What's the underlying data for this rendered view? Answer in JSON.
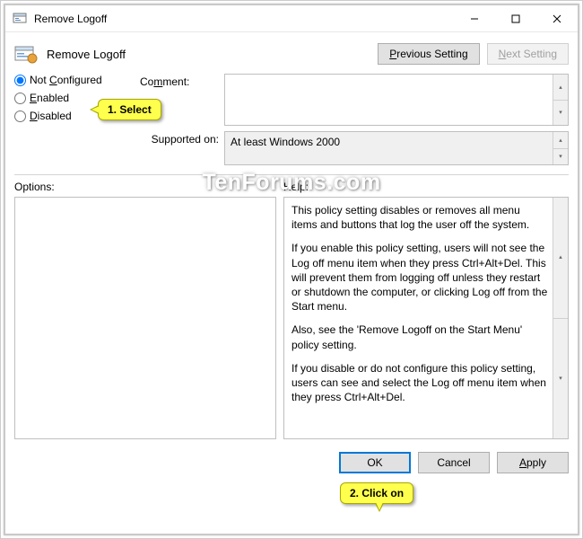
{
  "titlebar": {
    "title": "Remove Logoff"
  },
  "header": {
    "title": "Remove Logoff"
  },
  "nav": {
    "prev": "Previous Setting",
    "next": "Next Setting"
  },
  "radios": {
    "not_configured": "Not Configured",
    "enabled": "Enabled",
    "disabled": "Disabled"
  },
  "fields": {
    "comment_label": "Comment:",
    "comment_value": "",
    "supported_label": "Supported on:",
    "supported_value": "At least Windows 2000"
  },
  "lower": {
    "options_label": "Options:",
    "help_label": "Help:",
    "help_p1": "This policy setting disables or removes all menu items and buttons that log the user off the system.",
    "help_p2": "If you enable this policy setting, users will not see the Log off menu item when they press Ctrl+Alt+Del. This will prevent them from logging off unless they restart or shutdown the computer, or clicking Log off from the Start menu.",
    "help_p3": "Also, see the 'Remove Logoff on the Start Menu' policy setting.",
    "help_p4": "If you disable or do not configure this policy setting, users can see and select the Log off menu item when they press Ctrl+Alt+Del."
  },
  "actions": {
    "ok": "OK",
    "cancel": "Cancel",
    "apply": "Apply"
  },
  "callouts": {
    "c1": "1. Select",
    "c2": "2. Click on"
  },
  "watermark": "TenForums.com"
}
